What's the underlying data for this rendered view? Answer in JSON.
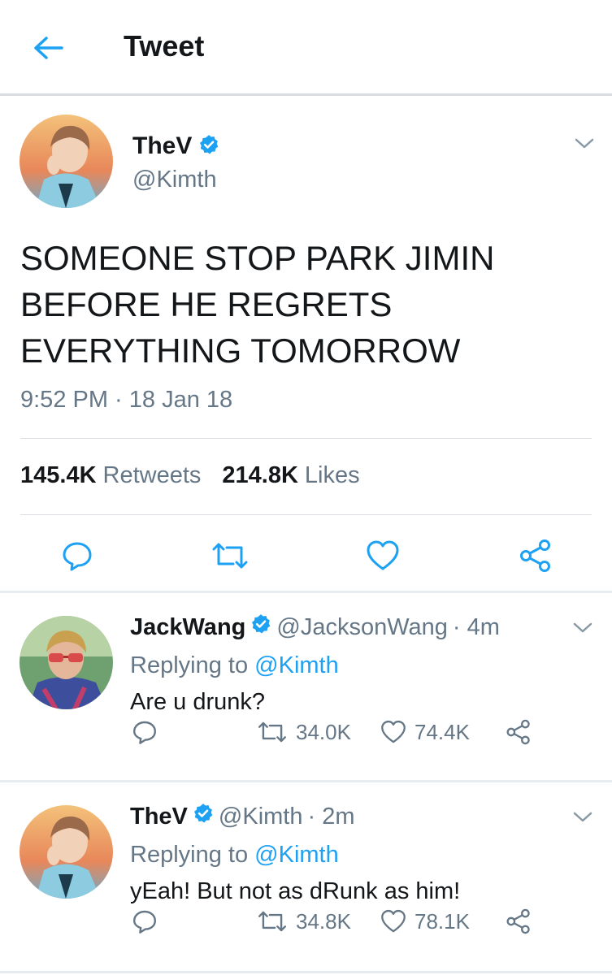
{
  "header": {
    "title": "Tweet",
    "back_icon": "arrow-left-icon"
  },
  "colors": {
    "accent": "#1da1f2",
    "text_primary": "#14171a",
    "text_secondary": "#657786",
    "border": "#e6ecf0"
  },
  "main_tweet": {
    "author_name": "TheV",
    "author_handle": "@Kimth",
    "verified": true,
    "text": "SOMEONE STOP PARK JIMIN BEFORE HE REGRETS EVERYTHING TOMORROW",
    "timestamp": "9:52 PM · 18 Jan 18",
    "retweets_count": "145.4K",
    "retweets_label": "Retweets",
    "likes_count": "214.8K",
    "likes_label": "Likes",
    "actions": [
      "reply-icon",
      "retweet-icon",
      "like-icon",
      "share-icon"
    ]
  },
  "replies": [
    {
      "author_name": "JackWang",
      "author_handle": "@JacksonWang",
      "time": "· 4m",
      "verified": true,
      "replying_label": "Replying to",
      "replying_to": "@Kimth",
      "text": "Are u drunk?",
      "retweets": "34.0K",
      "likes": "74.4K"
    },
    {
      "author_name": "TheV",
      "author_handle": "@Kimth",
      "time": "· 2m",
      "verified": true,
      "replying_label": "Replying to",
      "replying_to": "@Kimth",
      "text": "yEah! But not as dRunk as him!",
      "retweets": "34.8K",
      "likes": "78.1K"
    }
  ]
}
